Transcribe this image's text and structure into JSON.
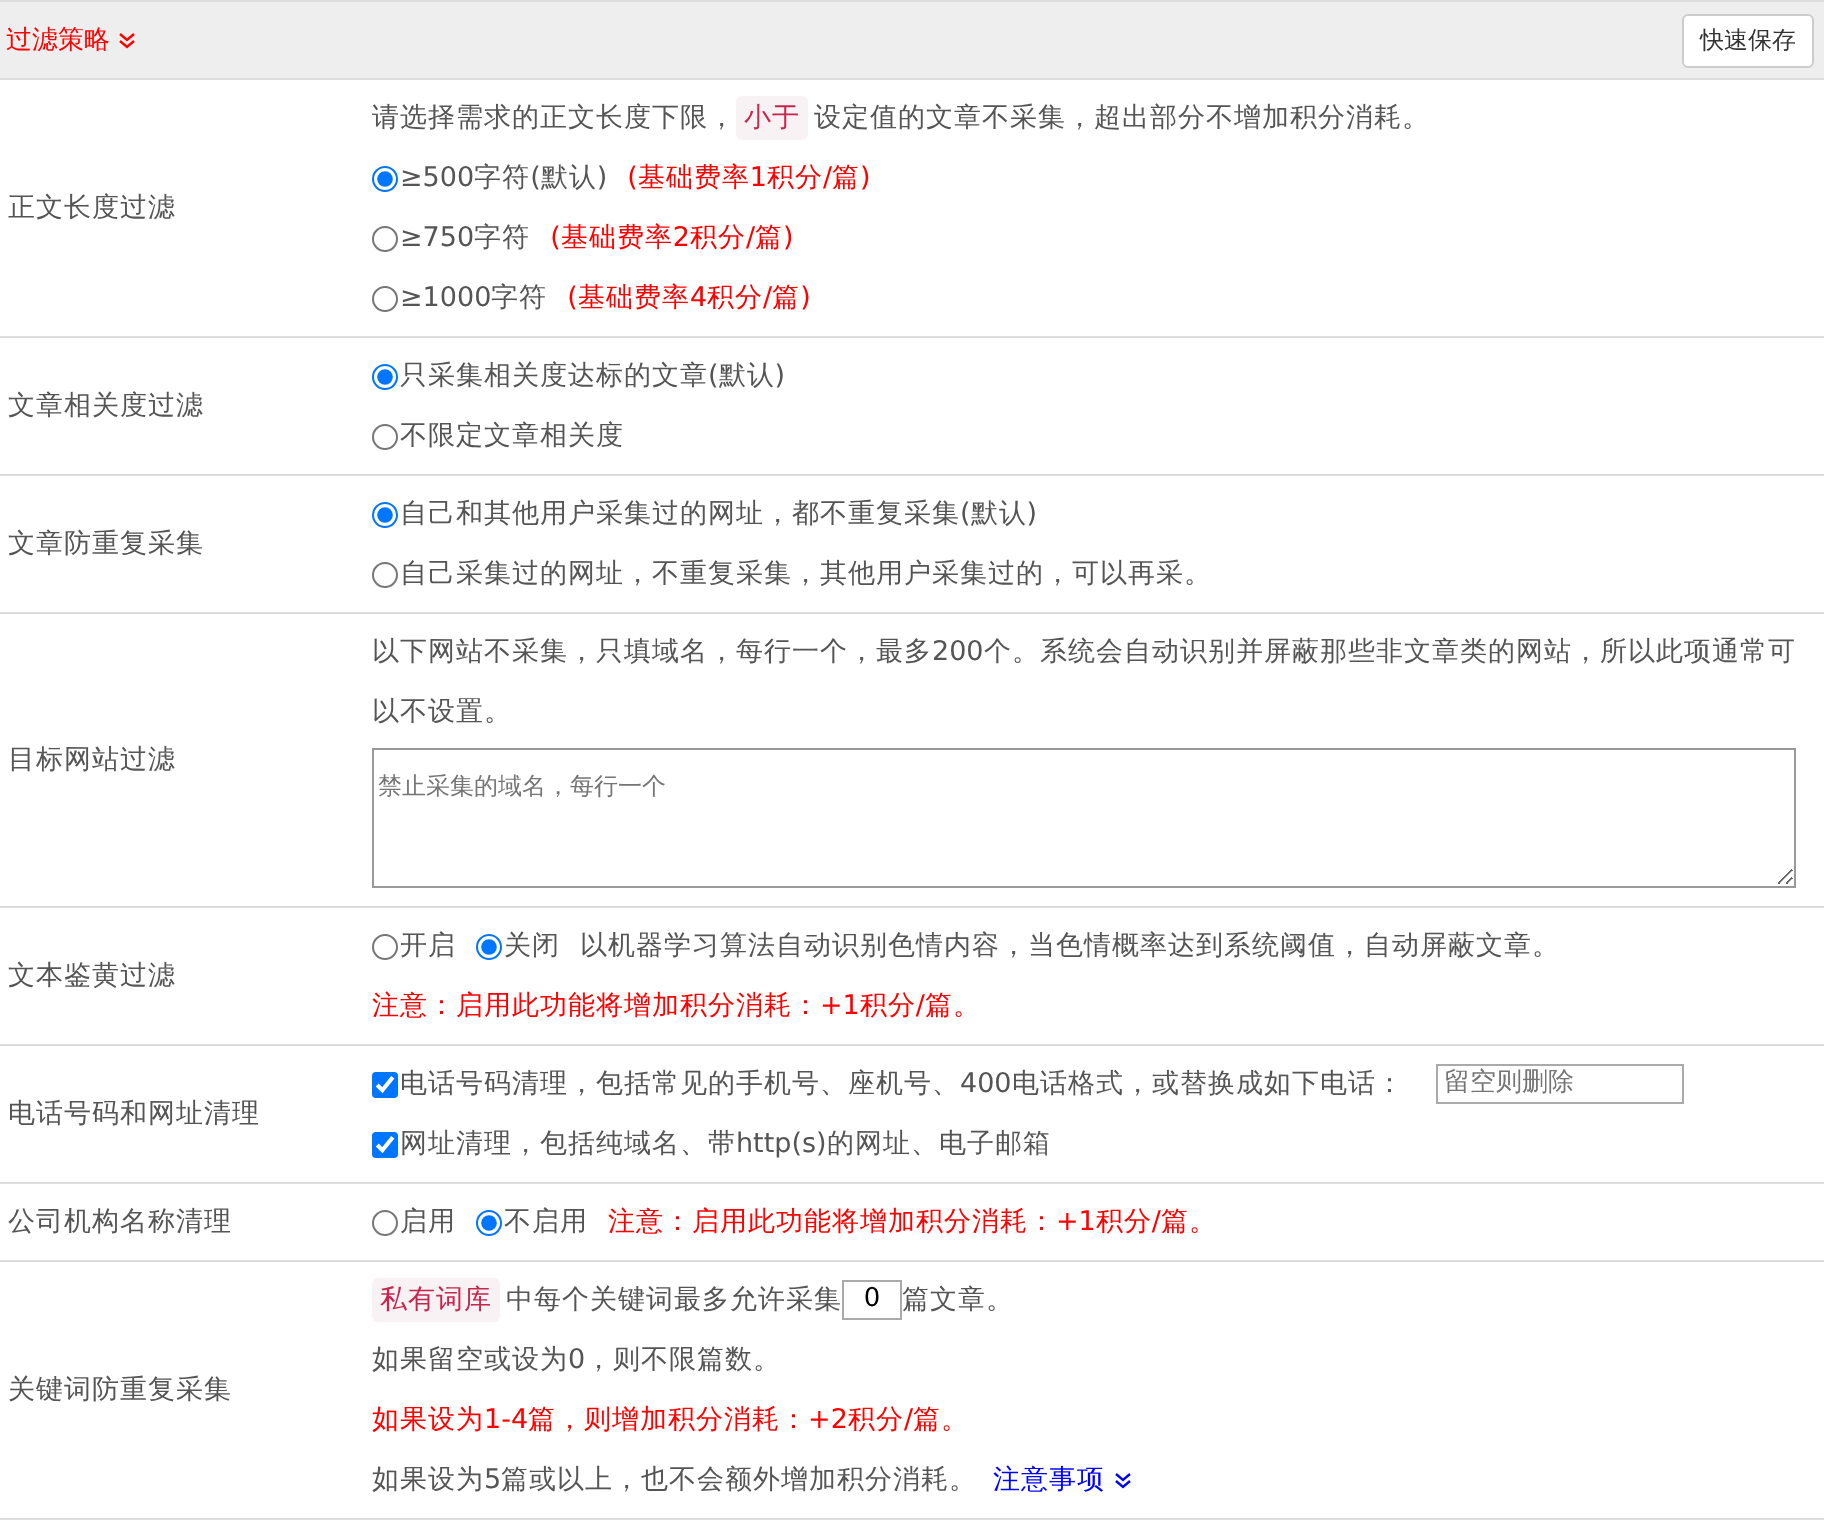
{
  "header": {
    "title": "过滤策略",
    "button": "快速保存"
  },
  "rows": [
    {
      "label": "正文长度过滤",
      "lines": [
        [
          {
            "kind": "text",
            "text": "请选择需求的正文长度下限，"
          },
          {
            "kind": "tag",
            "text": "小于"
          },
          {
            "kind": "text",
            "text": "设定值的文章不采集，超出部分不增加积分消耗。"
          }
        ],
        [
          {
            "kind": "radio",
            "text": "≥500字符(默认)",
            "selected": true
          },
          {
            "kind": "warn",
            "text": "(基础费率1积分/篇)"
          }
        ],
        [
          {
            "kind": "radio",
            "text": "≥750字符",
            "selected": false
          },
          {
            "kind": "warn",
            "text": "(基础费率2积分/篇)"
          }
        ],
        [
          {
            "kind": "radio",
            "text": "≥1000字符",
            "selected": false
          },
          {
            "kind": "warn",
            "text": "(基础费率4积分/篇)"
          }
        ]
      ]
    },
    {
      "label": "文章相关度过滤",
      "lines": [
        [
          {
            "kind": "radio",
            "text": "只采集相关度达标的文章(默认)",
            "selected": true
          }
        ],
        [
          {
            "kind": "radio",
            "text": "不限定文章相关度",
            "selected": false
          }
        ]
      ]
    },
    {
      "label": "文章防重复采集",
      "lines": [
        [
          {
            "kind": "radio",
            "text": "自己和其他用户采集过的网址，都不重复采集(默认)",
            "selected": true
          }
        ],
        [
          {
            "kind": "radio",
            "text": "自己采集过的网址，不重复采集，其他用户采集过的，可以再采。",
            "selected": false
          }
        ]
      ]
    },
    {
      "label": "目标网站过滤",
      "lines": [
        [
          {
            "kind": "text",
            "text": "以下网站不采集，只填域名，每行一个，最多200个。系统会自动识别并屏蔽那些非文章类的网站，所以此项通常可以不设置。"
          }
        ],
        [
          {
            "kind": "textarea",
            "placeholder": "禁止采集的域名，每行一个"
          }
        ]
      ]
    },
    {
      "label": "文本鉴黄过滤",
      "lines": [
        [
          {
            "kind": "radio",
            "text": "开启",
            "selected": false
          },
          {
            "kind": "radio",
            "text": "关闭",
            "selected": true
          },
          {
            "kind": "text",
            "text": "以机器学习算法自动识别色情内容，当色情概率达到系统阈值，自动屏蔽文章。"
          }
        ],
        [
          {
            "kind": "warn",
            "text": "注意：启用此功能将增加积分消耗：+1积分/篇。"
          }
        ]
      ]
    },
    {
      "label": "电话号码和网址清理",
      "lines": [
        [
          {
            "kind": "checkbox",
            "text": "电话号码清理，包括常见的手机号、座机号、400电话格式，或替换成如下电话：",
            "checked": true
          },
          {
            "kind": "input",
            "placeholder": "留空则删除"
          }
        ],
        [
          {
            "kind": "checkbox",
            "text": "网址清理，包括纯域名、带http(s)的网址、电子邮箱",
            "checked": true
          }
        ]
      ]
    },
    {
      "label": "公司机构名称清理",
      "lines": [
        [
          {
            "kind": "radio",
            "text": "启用",
            "selected": false
          },
          {
            "kind": "radio",
            "text": "不启用",
            "selected": true
          },
          {
            "kind": "warn",
            "text": "注意：启用此功能将增加积分消耗：+1积分/篇。"
          }
        ]
      ]
    },
    {
      "label": "关键词防重复采集",
      "lines": [
        [
          {
            "kind": "tag",
            "text": "私有词库"
          },
          {
            "kind": "text",
            "text": "中每个关键词最多允许采集"
          },
          {
            "kind": "number",
            "value": "0"
          },
          {
            "kind": "text",
            "text": "篇文章。"
          }
        ],
        [
          {
            "kind": "text",
            "text": "如果留空或设为0，则不限篇数。"
          }
        ],
        [
          {
            "kind": "warn",
            "text": "如果设为1-4篇，则增加积分消耗：+2积分/篇。"
          }
        ],
        [
          {
            "kind": "text",
            "text": "如果设为5篇或以上，也不会额外增加积分消耗。"
          },
          {
            "kind": "link",
            "text": "注意事项"
          }
        ]
      ]
    }
  ]
}
